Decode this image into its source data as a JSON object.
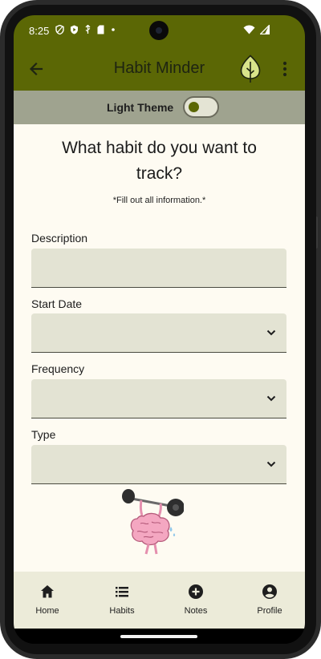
{
  "status_bar": {
    "time": "8:25"
  },
  "app_bar": {
    "title": "Habit Minder"
  },
  "theme": {
    "label": "Light Theme",
    "enabled": false
  },
  "form": {
    "question": "What habit do you want to track?",
    "note": "*Fill out all information.*",
    "fields": [
      {
        "label": "Description",
        "value": "",
        "type": "text"
      },
      {
        "label": "Start Date",
        "value": "",
        "type": "dropdown"
      },
      {
        "label": "Frequency",
        "value": "",
        "type": "dropdown"
      },
      {
        "label": "Type",
        "value": "",
        "type": "dropdown"
      }
    ]
  },
  "bottom_nav": {
    "items": [
      {
        "label": "Home",
        "icon": "home-icon"
      },
      {
        "label": "Habits",
        "icon": "list-icon"
      },
      {
        "label": "Notes",
        "icon": "add-circle-icon"
      },
      {
        "label": "Profile",
        "icon": "account-circle-icon"
      }
    ]
  },
  "colors": {
    "primary": "#5b6705",
    "theme_bar": "#9fa38f",
    "background": "#fefbf2",
    "field_fill": "#e3e3d3",
    "nav_background": "#ecebd9"
  }
}
